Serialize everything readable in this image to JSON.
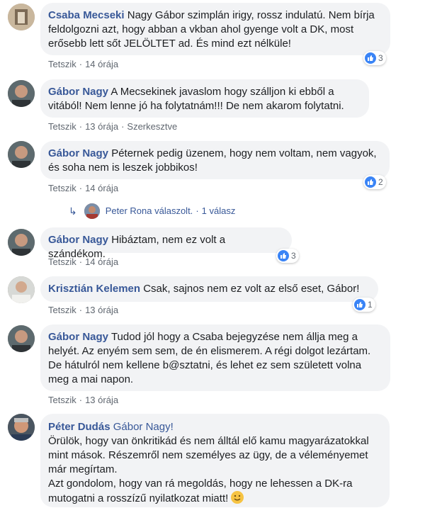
{
  "comments": [
    {
      "name": "Csaba Mecseki",
      "text": "Nagy Gábor szimplán irigy, rossz indulatú. Nem bírja feldolgozni azt, hogy abban a vkban ahol gyenge volt a DK, most erősebb lett sőt JELÖLTET ad. És mind ezt nélküle!",
      "like": "Tetszik",
      "time": "14 órája",
      "reactions": "3"
    },
    {
      "name": "Gábor Nagy",
      "text": "A Mecsekinek javaslom hogy szálljon ki ebből a vitából! Nem lenne jó ha folytatnám!!! De nem akarom folytatni.",
      "like": "Tetszik",
      "time": "13 órája",
      "edit": "Szerkesztve"
    },
    {
      "name": "Gábor Nagy",
      "text": "Péternek pedig üzenem, hogy nem voltam, nem vagyok, és soha nem is leszek jobbikos!",
      "like": "Tetszik",
      "time": "14 órája",
      "reactions": "2",
      "reply": {
        "text": "Peter Rona válaszolt.",
        "count": "1 válasz"
      }
    },
    {
      "name": "Gábor Nagy",
      "text": "Hibáztam, nem ez volt a szándékom.",
      "like": "Tetszik",
      "time": "14 órája",
      "reactions": "3"
    },
    {
      "name": "Krisztián Kelemen",
      "text": "Csak, sajnos nem ez volt az első eset, Gábor!",
      "like": "Tetszik",
      "time": "13 órája",
      "reactions": "1"
    },
    {
      "name": "Gábor Nagy",
      "text": "Tudod jól hogy a Csaba bejegyzése nem állja meg a helyét. Az enyém sem sem, de én elismerem. A régi dolgot lezártam. De hátulról nem kellene b@sztatni, és lehet ez sem született volna meg a mai napon.",
      "like": "Tetszik",
      "time": "13 órája"
    },
    {
      "name": "Péter Dudás",
      "tag": "Gábor Nagy!",
      "line1": "Örülök, hogy van önkritikád és nem álltál elő kamu magyarázatokkal mint mások. Részemről nem személyes az ügy, de a véleményemet már megírtam.",
      "line2": "Azt gondolom, hogy van rá megoldás, hogy ne lehessen a DK-ra mutogatni a rosszízű nyilatkozat miatt!"
    }
  ],
  "separator": "·",
  "colors": {
    "name": "#385898",
    "bubble": "#f2f3f5",
    "like": "#3a84f6"
  }
}
